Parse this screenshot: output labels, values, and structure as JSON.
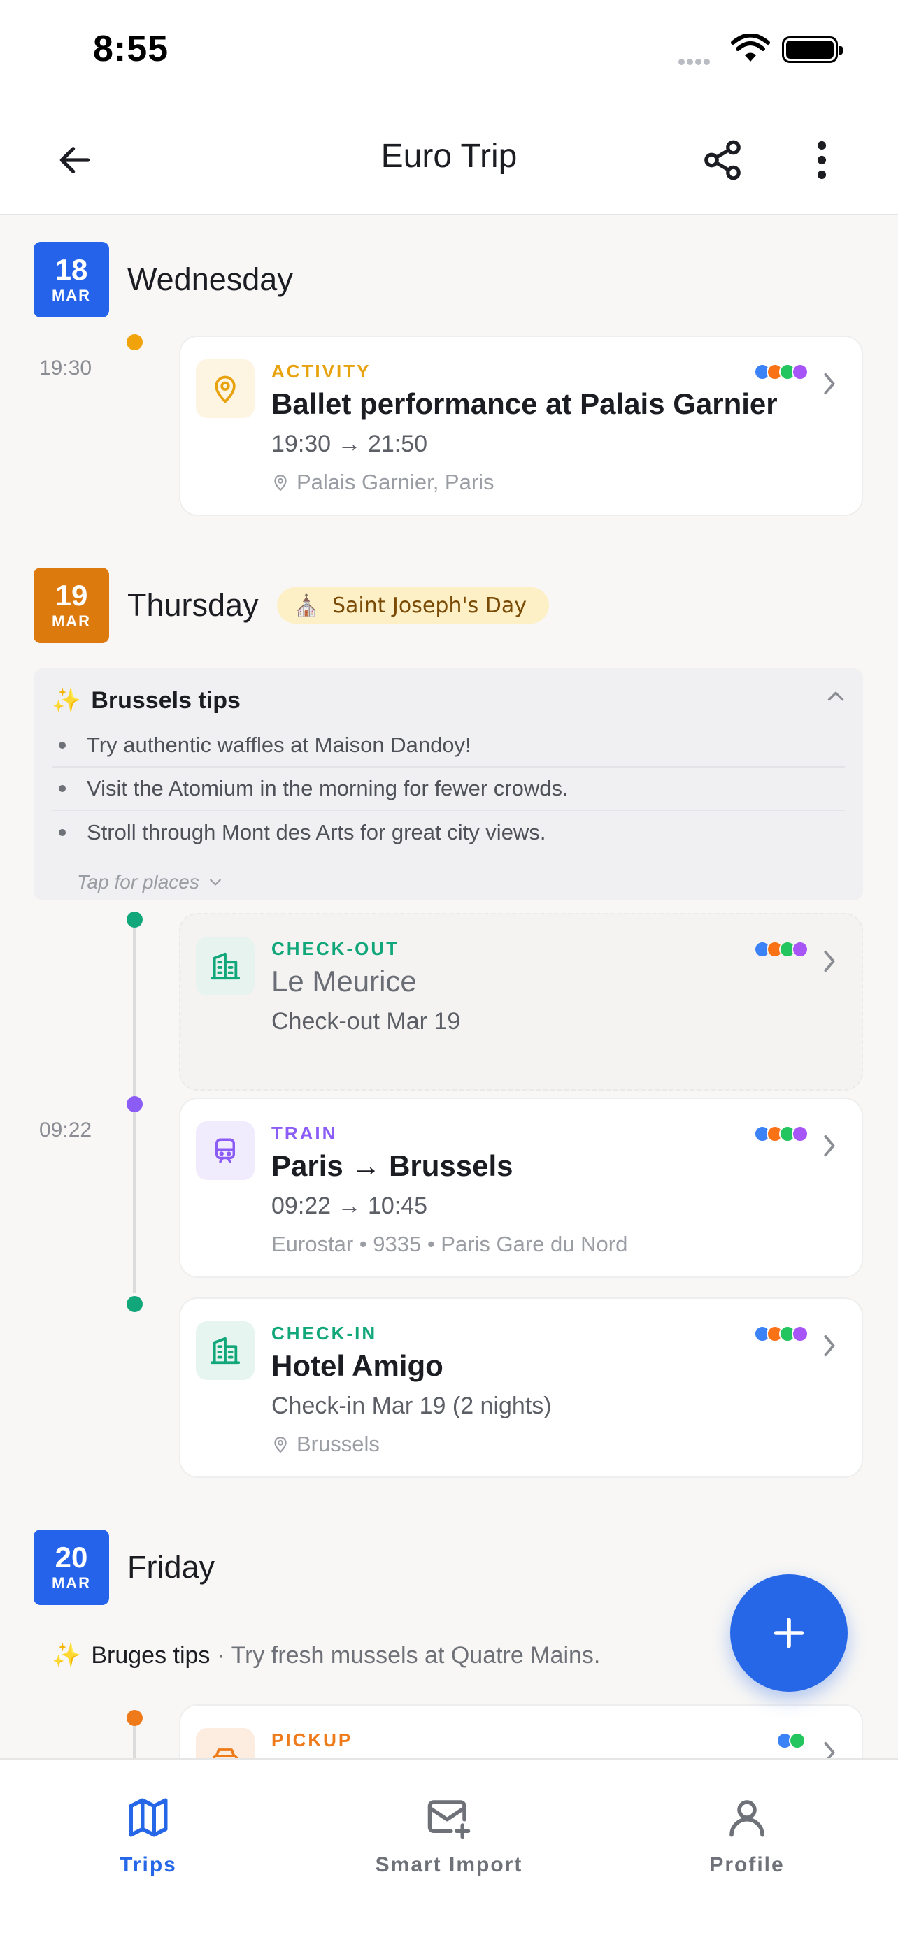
{
  "status_bar": {
    "time": "8:55"
  },
  "header": {
    "title": "Euro Trip",
    "back_icon": "arrow-left-icon",
    "share_icon": "share-icon",
    "more_icon": "more-vertical-icon"
  },
  "colors": {
    "accent": "#2667e8",
    "activity": "#e8a20c",
    "checkout": "#12a77a",
    "train": "#8b5cf6",
    "pickup": "#ef7a1a"
  },
  "days": [
    {
      "day": "18",
      "month": "MAR",
      "name": "Wednesday",
      "badge_color": "#2563eb"
    },
    {
      "day": "19",
      "month": "MAR",
      "name": "Thursday",
      "badge_color": "#dc7a0e",
      "holiday": "Saint Joseph's Day"
    },
    {
      "day": "20",
      "month": "MAR",
      "name": "Friday",
      "badge_color": "#2563eb"
    }
  ],
  "items": [
    {
      "time": "19:30",
      "type": "ACTIVITY",
      "title": "Ballet performance at Palais Garnier",
      "line": "19:30 → 21:50",
      "sub": "Palais Garnier, Paris"
    },
    {
      "time": "",
      "type": "CHECK-OUT",
      "title": "Le Meurice",
      "line": "Check-out Mar 19",
      "sub": ""
    },
    {
      "time": "09:22",
      "type": "TRAIN",
      "title": "Paris → Brussels",
      "line": "09:22 → 10:45",
      "sub": "Eurostar • 9335 • Paris Gare du Nord"
    },
    {
      "time": "",
      "type": "CHECK-IN",
      "title": "Hotel Amigo",
      "line": "Check-in Mar 19 (2 nights)",
      "sub": "Brussels"
    },
    {
      "time": "",
      "type": "PICKUP",
      "title": "",
      "line": "",
      "sub": ""
    }
  ],
  "tips": {
    "title": "Brussels tips",
    "items": [
      "Try authentic waffles at Maison Dandoy!",
      "Visit the Atomium in the morning for fewer crowds.",
      "Stroll through Mont des Arts for great city views."
    ],
    "more": "Tap for places"
  },
  "bruges_tips": {
    "title": "Bruges tips",
    "text": "· Try fresh mussels at Quatre Mains."
  },
  "fab": {
    "icon": "plus-icon"
  },
  "tabs": [
    {
      "label": "Trips",
      "icon": "map-icon",
      "active": true
    },
    {
      "label": "Smart Import",
      "icon": "mail-plus-icon",
      "active": false
    },
    {
      "label": "Profile",
      "icon": "user-icon",
      "active": false
    }
  ]
}
